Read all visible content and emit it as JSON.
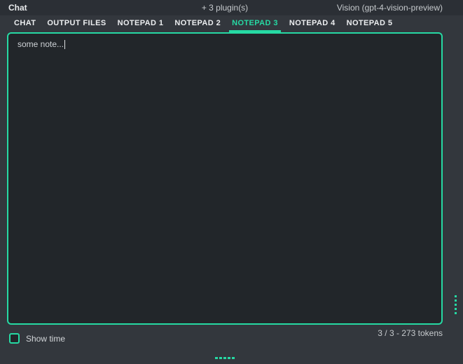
{
  "colors": {
    "accent": "#26d9a3",
    "topbar_bg": "#2b2f35",
    "main_bg": "#33373d",
    "editor_bg": "#22262a"
  },
  "topbar": {
    "title": "Chat",
    "plugins": "+ 3 plugin(s)",
    "model": "Vision (gpt-4-vision-preview)"
  },
  "tabs": [
    {
      "label": "CHAT",
      "active": false
    },
    {
      "label": "OUTPUT FILES",
      "active": false
    },
    {
      "label": "NOTEPAD 1",
      "active": false
    },
    {
      "label": "NOTEPAD 2",
      "active": false
    },
    {
      "label": "NOTEPAD 3",
      "active": true
    },
    {
      "label": "NOTEPAD 4",
      "active": false
    },
    {
      "label": "NOTEPAD 5",
      "active": false
    }
  ],
  "notepad": {
    "text": "some note..."
  },
  "statusbar": {
    "show_time_label": "Show time",
    "show_time_checked": false,
    "tokens": "3 / 3 - 273 tokens"
  },
  "icons": {
    "vertical_splitter": "dots-vertical-drag-handle",
    "horizontal_splitter": "dots-horizontal-drag-handle"
  }
}
